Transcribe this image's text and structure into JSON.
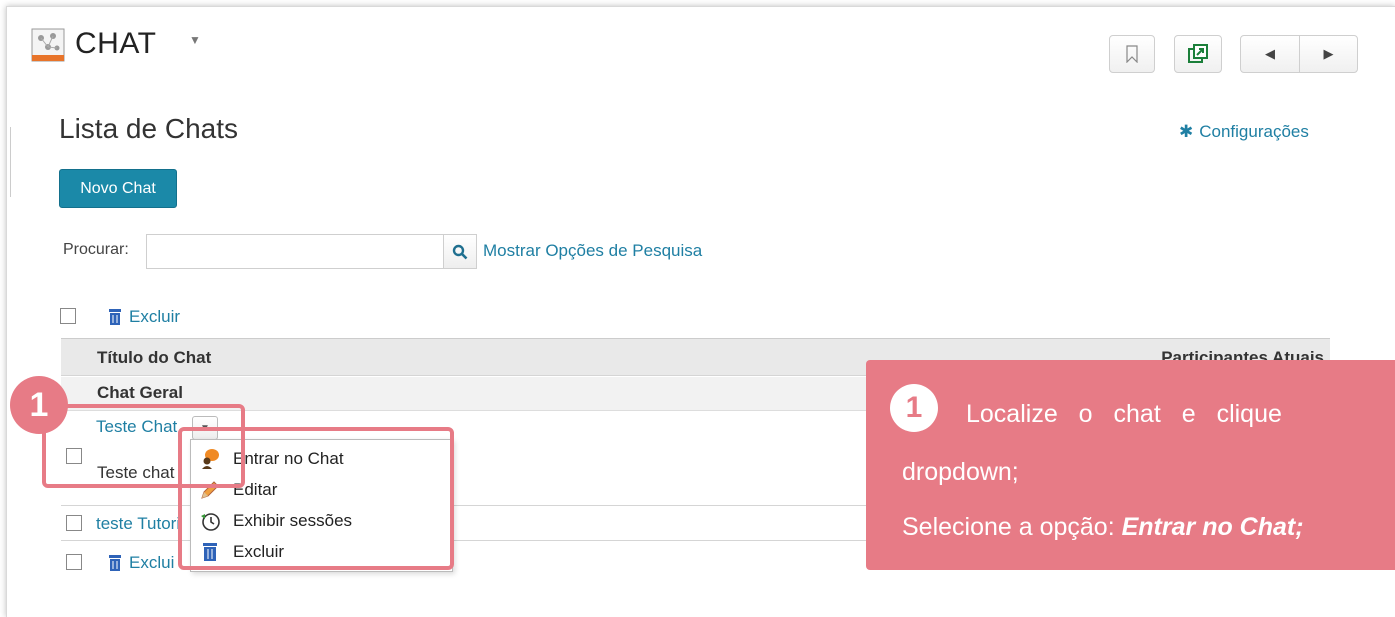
{
  "header": {
    "app_title": "CHAT",
    "app_icon": "chat-app-icon",
    "bookmark_icon": "bookmark-icon",
    "popout_icon": "popout-icon",
    "prev_icon": "triangle-left-icon",
    "next_icon": "triangle-right-icon"
  },
  "page": {
    "title": "Lista de Chats",
    "settings_label": "Configurações",
    "new_button": "Novo Chat"
  },
  "search": {
    "label": "Procurar:",
    "value": "",
    "placeholder": "",
    "options_link": "Mostrar Opções de Pesquisa"
  },
  "bulk": {
    "delete_label": "Excluir",
    "delete_label_cut": "Exclui"
  },
  "table": {
    "columns": [
      "Título do Chat",
      "Participantes Atuais"
    ],
    "group": "Chat Geral",
    "rows": [
      {
        "title": "Teste Chat",
        "description": "Teste chat"
      },
      {
        "title": "teste Tutori"
      }
    ]
  },
  "dropdown": {
    "items": [
      {
        "label": "Entrar no Chat",
        "icon": "person-chat-icon"
      },
      {
        "label": "Editar",
        "icon": "pencil-icon"
      },
      {
        "label": "Exhibir sessões",
        "icon": "clock-history-icon"
      },
      {
        "label": "Excluir",
        "icon": "trash-icon"
      }
    ]
  },
  "annotation": {
    "number": "1",
    "line1": "Localize o chat e clique",
    "line2": "dropdown;",
    "line3_prefix": "Selecione a opção: ",
    "line3_emph": "Entrar no Chat;"
  },
  "colors": {
    "accent": "#1b89a8",
    "link": "#1f7fa3",
    "annotation": "#e77b86"
  }
}
